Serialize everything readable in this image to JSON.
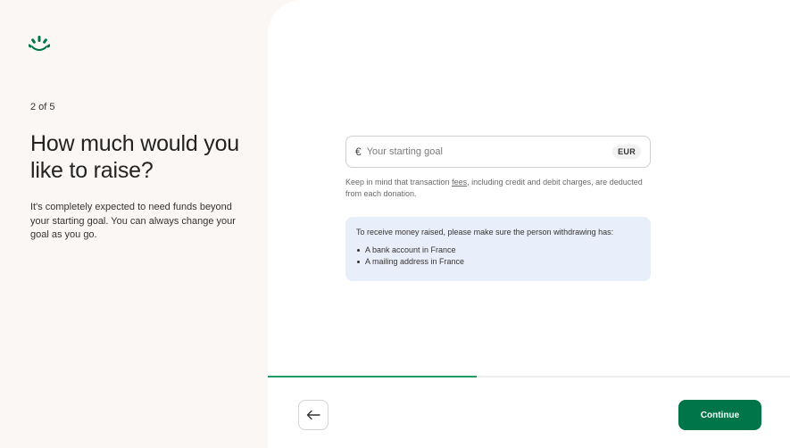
{
  "brand": {
    "logo_icon": "gofundme-sprout-icon",
    "accent": "#00754a"
  },
  "sidebar": {
    "step": "2 of 5",
    "heading": "How much would you like to raise?",
    "description": "It's completely expected to need funds beyond your starting goal. You can always change your goal as you go."
  },
  "goal": {
    "currency_symbol": "€",
    "placeholder": "Your starting goal",
    "value": "",
    "currency_code": "EUR"
  },
  "fees_note": {
    "before": "Keep in mind that transaction ",
    "link": "fees",
    "after": ", including credit and debit charges, are deducted from each donation."
  },
  "info_box": {
    "title": "To receive money raised, please make sure the person withdrawing has:",
    "items": [
      "A bank account in France",
      "A mailing address in France"
    ]
  },
  "progress": {
    "fraction": 0.4
  },
  "footer": {
    "back_icon": "arrow-left-icon",
    "continue_label": "Continue"
  }
}
